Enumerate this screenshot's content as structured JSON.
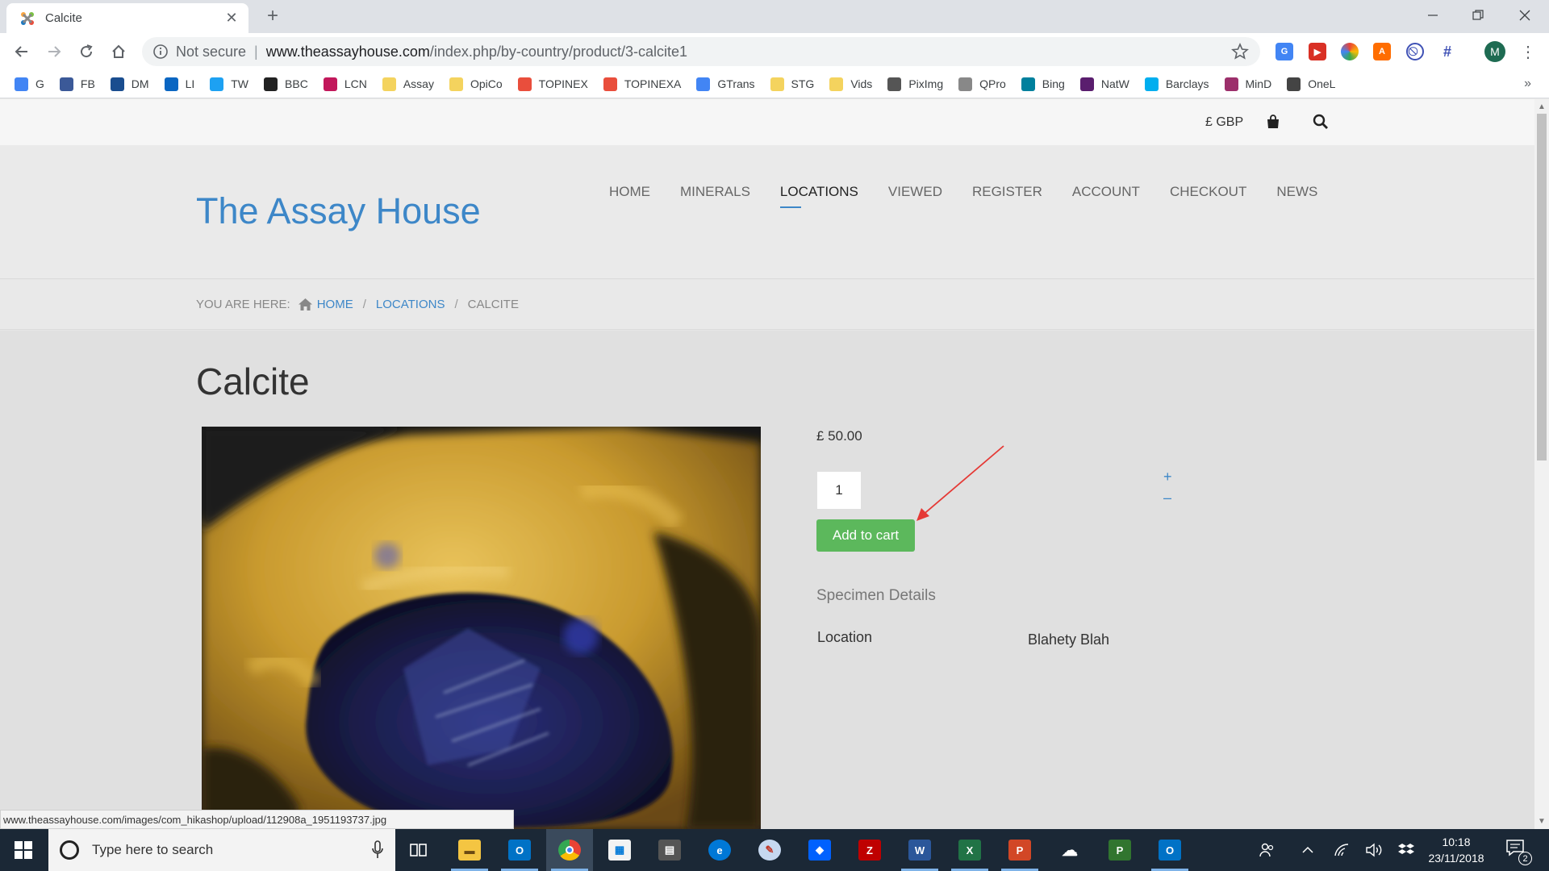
{
  "browser": {
    "tab_title": "Calcite",
    "new_tab_symbol": "+",
    "tab_close_symbol": "✕",
    "address": {
      "security_label": "Not secure",
      "separator": "|",
      "host": "www.theassayhouse.com",
      "path": "/index.php/by-country/product/3-calcite1"
    },
    "profile_initial": "M",
    "menu_symbol": "⋮",
    "bookmarks": [
      {
        "label": "G",
        "icon": "google-icon",
        "color": "#4285f4"
      },
      {
        "label": "FB",
        "icon": "facebook-icon",
        "color": "#3b5998"
      },
      {
        "label": "DM",
        "icon": "dm-icon",
        "color": "#1a4d8f"
      },
      {
        "label": "LI",
        "icon": "linkedin-icon",
        "color": "#0a66c2"
      },
      {
        "label": "TW",
        "icon": "twitter-icon",
        "color": "#1da1f2"
      },
      {
        "label": "BBC",
        "icon": "bbc-icon",
        "color": "#222222"
      },
      {
        "label": "LCN",
        "icon": "lcn-icon",
        "color": "#c2185b"
      },
      {
        "label": "Assay",
        "icon": "folder-icon",
        "color": "#f4d35e"
      },
      {
        "label": "OpiCo",
        "icon": "folder-icon",
        "color": "#f4d35e"
      },
      {
        "label": "TOPINEX",
        "icon": "joomla-icon",
        "color": "#e94e3c"
      },
      {
        "label": "TOPINEXA",
        "icon": "joomla-icon",
        "color": "#e94e3c"
      },
      {
        "label": "GTrans",
        "icon": "translate-icon",
        "color": "#4285f4"
      },
      {
        "label": "STG",
        "icon": "folder-icon",
        "color": "#f4d35e"
      },
      {
        "label": "Vids",
        "icon": "folder-icon",
        "color": "#f4d35e"
      },
      {
        "label": "PixImg",
        "icon": "aperture-icon",
        "color": "#555555"
      },
      {
        "label": "QPro",
        "icon": "page-icon",
        "color": "#888888"
      },
      {
        "label": "Bing",
        "icon": "bing-icon",
        "color": "#00809d"
      },
      {
        "label": "NatW",
        "icon": "natwest-icon",
        "color": "#5a1e6e"
      },
      {
        "label": "Barclays",
        "icon": "barclays-icon",
        "color": "#00aeef"
      },
      {
        "label": "MinD",
        "icon": "mind-icon",
        "color": "#9c2f6b"
      },
      {
        "label": "OneL",
        "icon": "onel-icon",
        "color": "#444444"
      }
    ],
    "bookmarks_more": "»"
  },
  "site": {
    "currency": "£ GBP",
    "logo": "The Assay House",
    "nav": [
      {
        "label": "HOME",
        "active": false
      },
      {
        "label": "MINERALS",
        "active": false
      },
      {
        "label": "LOCATIONS",
        "active": true
      },
      {
        "label": "VIEWED",
        "active": false
      },
      {
        "label": "REGISTER",
        "active": false
      },
      {
        "label": "ACCOUNT",
        "active": false
      },
      {
        "label": "CHECKOUT",
        "active": false
      },
      {
        "label": "NEWS",
        "active": false
      }
    ],
    "breadcrumb": {
      "label": "YOU ARE HERE:",
      "home": "HOME",
      "locations": "LOCATIONS",
      "current": "CALCITE",
      "separator": "/"
    },
    "accent_color": "#3d87c8",
    "button_color": "#5cb85c"
  },
  "product": {
    "title": "Calcite",
    "price": "£ 50.00",
    "quantity": "1",
    "qty_plus": "+",
    "qty_minus": "–",
    "add_to_cart": "Add to cart",
    "spec_heading": "Specimen Details",
    "specs": [
      {
        "label": "Location",
        "value": "Blahety Blah"
      }
    ]
  },
  "status_url": "www.theassayhouse.com/images/com_hikashop/upload/112908a_1951193737.jpg",
  "taskbar": {
    "search_placeholder": "Type here to search",
    "time": "10:18",
    "date": "23/11/2018",
    "notification_count": "2"
  }
}
